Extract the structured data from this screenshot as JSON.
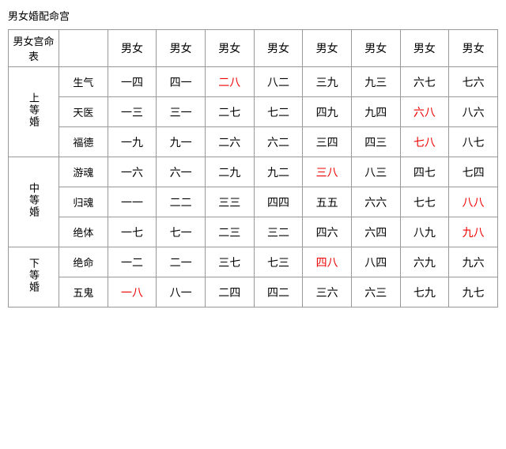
{
  "title": "男女婚配命宫",
  "table": {
    "header": {
      "row_label": "男女宫命表",
      "cols": [
        "男女",
        "男女",
        "男女",
        "男女",
        "男女",
        "男女",
        "男女",
        "男女"
      ]
    },
    "tiers": [
      {
        "tier_label": "上等婚",
        "rows": [
          {
            "sub_label": "生气",
            "cells": [
              {
                "text": "一四",
                "red": false
              },
              {
                "text": "四一",
                "red": false
              },
              {
                "text": "二八",
                "red": true
              },
              {
                "text": "八二",
                "red": false
              },
              {
                "text": "三九",
                "red": false
              },
              {
                "text": "九三",
                "red": false
              },
              {
                "text": "六七",
                "red": false
              },
              {
                "text": "七六",
                "red": false
              }
            ]
          },
          {
            "sub_label": "天医",
            "cells": [
              {
                "text": "一三",
                "red": false
              },
              {
                "text": "三一",
                "red": false
              },
              {
                "text": "二七",
                "red": false
              },
              {
                "text": "七二",
                "red": false
              },
              {
                "text": "四九",
                "red": false
              },
              {
                "text": "九四",
                "red": false
              },
              {
                "text": "六八",
                "red": true
              },
              {
                "text": "八六",
                "red": false
              }
            ]
          },
          {
            "sub_label": "福德",
            "cells": [
              {
                "text": "一九",
                "red": false
              },
              {
                "text": "九一",
                "red": false
              },
              {
                "text": "二六",
                "red": false
              },
              {
                "text": "六二",
                "red": false
              },
              {
                "text": "三四",
                "red": false
              },
              {
                "text": "四三",
                "red": false
              },
              {
                "text": "七八",
                "red": true
              },
              {
                "text": "八七",
                "red": false
              }
            ]
          }
        ]
      },
      {
        "tier_label": "中等婚",
        "rows": [
          {
            "sub_label": "游魂",
            "cells": [
              {
                "text": "一六",
                "red": false
              },
              {
                "text": "六一",
                "red": false
              },
              {
                "text": "二九",
                "red": false
              },
              {
                "text": "九二",
                "red": false
              },
              {
                "text": "三八",
                "red": true
              },
              {
                "text": "八三",
                "red": false
              },
              {
                "text": "四七",
                "red": false
              },
              {
                "text": "七四",
                "red": false
              }
            ]
          },
          {
            "sub_label": "归魂",
            "cells": [
              {
                "text": "一一",
                "red": false
              },
              {
                "text": "二二",
                "red": false
              },
              {
                "text": "三三",
                "red": false
              },
              {
                "text": "四四",
                "red": false
              },
              {
                "text": "五五",
                "red": false
              },
              {
                "text": "六六",
                "red": false
              },
              {
                "text": "七七",
                "red": false
              },
              {
                "text": "八八",
                "red": true
              }
            ]
          },
          {
            "sub_label": "绝体",
            "cells": [
              {
                "text": "一七",
                "red": false
              },
              {
                "text": "七一",
                "red": false
              },
              {
                "text": "二三",
                "red": false
              },
              {
                "text": "三二",
                "red": false
              },
              {
                "text": "四六",
                "red": false
              },
              {
                "text": "六四",
                "red": false
              },
              {
                "text": "八九",
                "red": false
              },
              {
                "text": "九八",
                "red": true
              }
            ]
          }
        ]
      },
      {
        "tier_label": "下等婚",
        "rows": [
          {
            "sub_label": "绝命",
            "cells": [
              {
                "text": "一二",
                "red": false
              },
              {
                "text": "二一",
                "red": false
              },
              {
                "text": "三七",
                "red": false
              },
              {
                "text": "七三",
                "red": false
              },
              {
                "text": "四八",
                "red": true
              },
              {
                "text": "八四",
                "red": false
              },
              {
                "text": "六九",
                "red": false
              },
              {
                "text": "九六",
                "red": false
              }
            ]
          },
          {
            "sub_label": "五鬼",
            "cells": [
              {
                "text": "一八",
                "red": true
              },
              {
                "text": "八一",
                "red": false
              },
              {
                "text": "二四",
                "red": false
              },
              {
                "text": "四二",
                "red": false
              },
              {
                "text": "三六",
                "red": false
              },
              {
                "text": "六三",
                "red": false
              },
              {
                "text": "七九",
                "red": false
              },
              {
                "text": "九七",
                "red": false
              }
            ]
          }
        ]
      }
    ]
  }
}
